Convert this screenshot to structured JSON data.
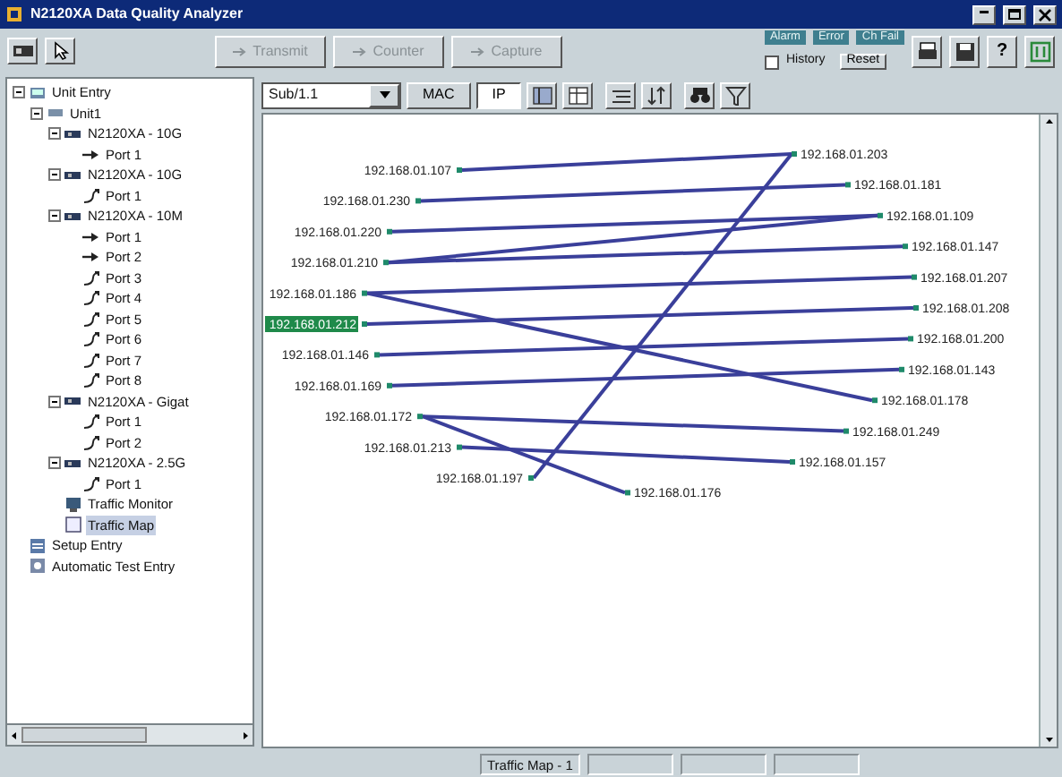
{
  "window": {
    "title": "N2120XA Data Quality Analyzer"
  },
  "toolbar": {
    "actions": [
      {
        "label": "Transmit",
        "disabled": true
      },
      {
        "label": "Counter",
        "disabled": true
      },
      {
        "label": "Capture",
        "disabled": true
      }
    ],
    "indicators": [
      "Alarm",
      "Error",
      "Ch Fail"
    ],
    "history": {
      "label": "History",
      "checked": false
    },
    "reset": "Reset",
    "help": "?"
  },
  "tree": [
    {
      "label": "Unit Entry",
      "kind": "entry",
      "expanded": true,
      "selected": false,
      "children": [
        {
          "label": "Unit1",
          "kind": "unit",
          "expanded": true,
          "selected": false,
          "children": [
            {
              "label": "N2120XA - 10G",
              "kind": "card",
              "expanded": true,
              "selected": false,
              "children": [
                {
                  "label": "Port 1",
                  "kind": "port",
                  "connected": true,
                  "selected": false
                }
              ]
            },
            {
              "label": "N2120XA - 10G",
              "kind": "card",
              "expanded": true,
              "selected": false,
              "children": [
                {
                  "label": "Port 1",
                  "kind": "port",
                  "connected": false,
                  "selected": false
                }
              ]
            },
            {
              "label": "N2120XA - 10M",
              "kind": "card",
              "expanded": true,
              "selected": false,
              "children": [
                {
                  "label": "Port 1",
                  "kind": "port",
                  "connected": true,
                  "selected": false
                },
                {
                  "label": "Port 2",
                  "kind": "port",
                  "connected": true,
                  "selected": false
                },
                {
                  "label": "Port 3",
                  "kind": "port",
                  "connected": false,
                  "selected": false
                },
                {
                  "label": "Port 4",
                  "kind": "port",
                  "connected": false,
                  "selected": false
                },
                {
                  "label": "Port 5",
                  "kind": "port",
                  "connected": false,
                  "selected": false
                },
                {
                  "label": "Port 6",
                  "kind": "port",
                  "connected": false,
                  "selected": false
                },
                {
                  "label": "Port 7",
                  "kind": "port",
                  "connected": false,
                  "selected": false
                },
                {
                  "label": "Port 8",
                  "kind": "port",
                  "connected": false,
                  "selected": false
                }
              ]
            },
            {
              "label": "N2120XA - Gigat",
              "kind": "card",
              "expanded": true,
              "selected": false,
              "children": [
                {
                  "label": "Port 1",
                  "kind": "port",
                  "connected": false,
                  "selected": false
                },
                {
                  "label": "Port 2",
                  "kind": "port",
                  "connected": false,
                  "selected": false
                }
              ]
            },
            {
              "label": "N2120XA - 2.5G",
              "kind": "card",
              "expanded": true,
              "selected": false,
              "children": [
                {
                  "label": "Port 1",
                  "kind": "port",
                  "connected": false,
                  "selected": false
                }
              ]
            },
            {
              "label": "Traffic Monitor",
              "kind": "monitor",
              "selected": false
            },
            {
              "label": "Traffic Map",
              "kind": "map",
              "selected": true
            }
          ]
        }
      ]
    },
    {
      "label": "Setup Entry",
      "kind": "setup",
      "selected": false
    },
    {
      "label": "Automatic Test Entry",
      "kind": "test",
      "selected": false
    }
  ],
  "map_toolbar": {
    "subnet": "Sub/1.1",
    "modes": [
      {
        "label": "MAC",
        "selected": false
      },
      {
        "label": "IP",
        "selected": true
      }
    ]
  },
  "traffic_map": {
    "sources": [
      {
        "address": "192.168.01.107",
        "selected": false
      },
      {
        "address": "192.168.01.230",
        "selected": false
      },
      {
        "address": "192.168.01.220",
        "selected": false
      },
      {
        "address": "192.168.01.210",
        "selected": false
      },
      {
        "address": "192.168.01.186",
        "selected": false
      },
      {
        "address": "192.168.01.212",
        "selected": true
      },
      {
        "address": "192.168.01.146",
        "selected": false
      },
      {
        "address": "192.168.01.169",
        "selected": false
      },
      {
        "address": "192.168.01.172",
        "selected": false
      },
      {
        "address": "192.168.01.213",
        "selected": false
      },
      {
        "address": "192.168.01.197",
        "selected": false
      }
    ],
    "destinations": [
      {
        "address": "192.168.01.203"
      },
      {
        "address": "192.168.01.181"
      },
      {
        "address": "192.168.01.109"
      },
      {
        "address": "192.168.01.147"
      },
      {
        "address": "192.168.01.207"
      },
      {
        "address": "192.168.01.208"
      },
      {
        "address": "192.168.01.200"
      },
      {
        "address": "192.168.01.143"
      },
      {
        "address": "192.168.01.178"
      },
      {
        "address": "192.168.01.249"
      },
      {
        "address": "192.168.01.157"
      },
      {
        "address": "192.168.01.176"
      }
    ]
  },
  "status_bar": {
    "view": "Traffic Map - 1"
  }
}
